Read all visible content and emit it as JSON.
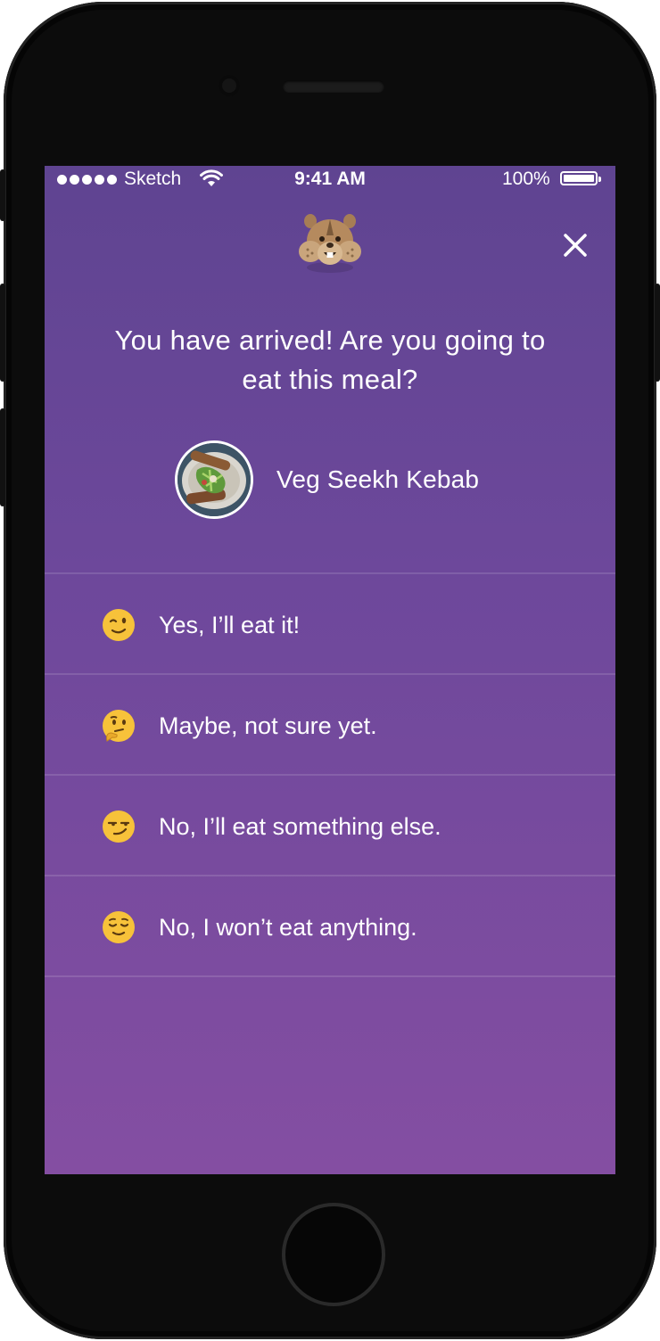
{
  "status_bar": {
    "carrier": "Sketch",
    "time": "9:41 AM",
    "battery": "100%"
  },
  "header": {
    "mascot_icon": "chipmunk-mascot-icon",
    "close_icon": "close-icon"
  },
  "prompt": {
    "question": "You have arrived! Are you going to eat this meal?"
  },
  "meal": {
    "name": "Veg Seekh Kebab",
    "image": "kebab-plate-photo"
  },
  "options": [
    {
      "emoji": "winking-face-icon",
      "label": "Yes, I’ll eat it!"
    },
    {
      "emoji": "thinking-face-icon",
      "label": "Maybe, not sure yet."
    },
    {
      "emoji": "smirking-face-icon",
      "label": "No, I’ll eat something else."
    },
    {
      "emoji": "relieved-face-icon",
      "label": "No, I won’t eat anything."
    }
  ],
  "colors": {
    "background_top": "#5f4491",
    "background_bottom": "#844ea2",
    "text": "#ffffff"
  }
}
